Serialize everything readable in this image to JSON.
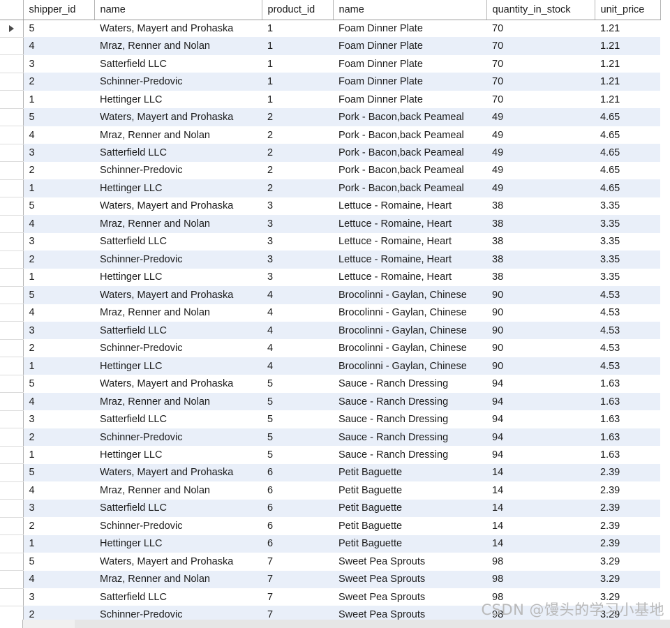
{
  "grid": {
    "columns": [
      {
        "key": "marker",
        "label": ""
      },
      {
        "key": "shipper_id",
        "label": "shipper_id"
      },
      {
        "key": "shipper_name",
        "label": "name"
      },
      {
        "key": "product_id",
        "label": "product_id"
      },
      {
        "key": "product_name",
        "label": "name"
      },
      {
        "key": "quantity_in_stock",
        "label": "quantity_in_stock"
      },
      {
        "key": "unit_price",
        "label": "unit_price"
      }
    ],
    "current_row_index": 0,
    "row_marker_icon": "triangle-right-icon",
    "colors": {
      "stripe": "#e9eff9",
      "background": "#ffffff",
      "grid_line": "#b4b4b4",
      "header_underline": "#9a9a9a",
      "text": "#1b1b1b"
    },
    "rows": [
      {
        "shipper_id": "5",
        "shipper_name": "Waters, Mayert and Prohaska",
        "product_id": "1",
        "product_name": "Foam Dinner Plate",
        "quantity_in_stock": "70",
        "unit_price": "1.21"
      },
      {
        "shipper_id": "4",
        "shipper_name": "Mraz, Renner and Nolan",
        "product_id": "1",
        "product_name": "Foam Dinner Plate",
        "quantity_in_stock": "70",
        "unit_price": "1.21"
      },
      {
        "shipper_id": "3",
        "shipper_name": "Satterfield LLC",
        "product_id": "1",
        "product_name": "Foam Dinner Plate",
        "quantity_in_stock": "70",
        "unit_price": "1.21"
      },
      {
        "shipper_id": "2",
        "shipper_name": "Schinner-Predovic",
        "product_id": "1",
        "product_name": "Foam Dinner Plate",
        "quantity_in_stock": "70",
        "unit_price": "1.21"
      },
      {
        "shipper_id": "1",
        "shipper_name": "Hettinger LLC",
        "product_id": "1",
        "product_name": "Foam Dinner Plate",
        "quantity_in_stock": "70",
        "unit_price": "1.21"
      },
      {
        "shipper_id": "5",
        "shipper_name": "Waters, Mayert and Prohaska",
        "product_id": "2",
        "product_name": "Pork - Bacon,back Peameal",
        "quantity_in_stock": "49",
        "unit_price": "4.65"
      },
      {
        "shipper_id": "4",
        "shipper_name": "Mraz, Renner and Nolan",
        "product_id": "2",
        "product_name": "Pork - Bacon,back Peameal",
        "quantity_in_stock": "49",
        "unit_price": "4.65"
      },
      {
        "shipper_id": "3",
        "shipper_name": "Satterfield LLC",
        "product_id": "2",
        "product_name": "Pork - Bacon,back Peameal",
        "quantity_in_stock": "49",
        "unit_price": "4.65"
      },
      {
        "shipper_id": "2",
        "shipper_name": "Schinner-Predovic",
        "product_id": "2",
        "product_name": "Pork - Bacon,back Peameal",
        "quantity_in_stock": "49",
        "unit_price": "4.65"
      },
      {
        "shipper_id": "1",
        "shipper_name": "Hettinger LLC",
        "product_id": "2",
        "product_name": "Pork - Bacon,back Peameal",
        "quantity_in_stock": "49",
        "unit_price": "4.65"
      },
      {
        "shipper_id": "5",
        "shipper_name": "Waters, Mayert and Prohaska",
        "product_id": "3",
        "product_name": "Lettuce - Romaine, Heart",
        "quantity_in_stock": "38",
        "unit_price": "3.35"
      },
      {
        "shipper_id": "4",
        "shipper_name": "Mraz, Renner and Nolan",
        "product_id": "3",
        "product_name": "Lettuce - Romaine, Heart",
        "quantity_in_stock": "38",
        "unit_price": "3.35"
      },
      {
        "shipper_id": "3",
        "shipper_name": "Satterfield LLC",
        "product_id": "3",
        "product_name": "Lettuce - Romaine, Heart",
        "quantity_in_stock": "38",
        "unit_price": "3.35"
      },
      {
        "shipper_id": "2",
        "shipper_name": "Schinner-Predovic",
        "product_id": "3",
        "product_name": "Lettuce - Romaine, Heart",
        "quantity_in_stock": "38",
        "unit_price": "3.35"
      },
      {
        "shipper_id": "1",
        "shipper_name": "Hettinger LLC",
        "product_id": "3",
        "product_name": "Lettuce - Romaine, Heart",
        "quantity_in_stock": "38",
        "unit_price": "3.35"
      },
      {
        "shipper_id": "5",
        "shipper_name": "Waters, Mayert and Prohaska",
        "product_id": "4",
        "product_name": "Brocolinni - Gaylan, Chinese",
        "quantity_in_stock": "90",
        "unit_price": "4.53"
      },
      {
        "shipper_id": "4",
        "shipper_name": "Mraz, Renner and Nolan",
        "product_id": "4",
        "product_name": "Brocolinni - Gaylan, Chinese",
        "quantity_in_stock": "90",
        "unit_price": "4.53"
      },
      {
        "shipper_id": "3",
        "shipper_name": "Satterfield LLC",
        "product_id": "4",
        "product_name": "Brocolinni - Gaylan, Chinese",
        "quantity_in_stock": "90",
        "unit_price": "4.53"
      },
      {
        "shipper_id": "2",
        "shipper_name": "Schinner-Predovic",
        "product_id": "4",
        "product_name": "Brocolinni - Gaylan, Chinese",
        "quantity_in_stock": "90",
        "unit_price": "4.53"
      },
      {
        "shipper_id": "1",
        "shipper_name": "Hettinger LLC",
        "product_id": "4",
        "product_name": "Brocolinni - Gaylan, Chinese",
        "quantity_in_stock": "90",
        "unit_price": "4.53"
      },
      {
        "shipper_id": "5",
        "shipper_name": "Waters, Mayert and Prohaska",
        "product_id": "5",
        "product_name": "Sauce - Ranch Dressing",
        "quantity_in_stock": "94",
        "unit_price": "1.63"
      },
      {
        "shipper_id": "4",
        "shipper_name": "Mraz, Renner and Nolan",
        "product_id": "5",
        "product_name": "Sauce - Ranch Dressing",
        "quantity_in_stock": "94",
        "unit_price": "1.63"
      },
      {
        "shipper_id": "3",
        "shipper_name": "Satterfield LLC",
        "product_id": "5",
        "product_name": "Sauce - Ranch Dressing",
        "quantity_in_stock": "94",
        "unit_price": "1.63"
      },
      {
        "shipper_id": "2",
        "shipper_name": "Schinner-Predovic",
        "product_id": "5",
        "product_name": "Sauce - Ranch Dressing",
        "quantity_in_stock": "94",
        "unit_price": "1.63"
      },
      {
        "shipper_id": "1",
        "shipper_name": "Hettinger LLC",
        "product_id": "5",
        "product_name": "Sauce - Ranch Dressing",
        "quantity_in_stock": "94",
        "unit_price": "1.63"
      },
      {
        "shipper_id": "5",
        "shipper_name": "Waters, Mayert and Prohaska",
        "product_id": "6",
        "product_name": "Petit Baguette",
        "quantity_in_stock": "14",
        "unit_price": "2.39"
      },
      {
        "shipper_id": "4",
        "shipper_name": "Mraz, Renner and Nolan",
        "product_id": "6",
        "product_name": "Petit Baguette",
        "quantity_in_stock": "14",
        "unit_price": "2.39"
      },
      {
        "shipper_id": "3",
        "shipper_name": "Satterfield LLC",
        "product_id": "6",
        "product_name": "Petit Baguette",
        "quantity_in_stock": "14",
        "unit_price": "2.39"
      },
      {
        "shipper_id": "2",
        "shipper_name": "Schinner-Predovic",
        "product_id": "6",
        "product_name": "Petit Baguette",
        "quantity_in_stock": "14",
        "unit_price": "2.39"
      },
      {
        "shipper_id": "1",
        "shipper_name": "Hettinger LLC",
        "product_id": "6",
        "product_name": "Petit Baguette",
        "quantity_in_stock": "14",
        "unit_price": "2.39"
      },
      {
        "shipper_id": "5",
        "shipper_name": "Waters, Mayert and Prohaska",
        "product_id": "7",
        "product_name": "Sweet Pea Sprouts",
        "quantity_in_stock": "98",
        "unit_price": "3.29"
      },
      {
        "shipper_id": "4",
        "shipper_name": "Mraz, Renner and Nolan",
        "product_id": "7",
        "product_name": "Sweet Pea Sprouts",
        "quantity_in_stock": "98",
        "unit_price": "3.29"
      },
      {
        "shipper_id": "3",
        "shipper_name": "Satterfield LLC",
        "product_id": "7",
        "product_name": "Sweet Pea Sprouts",
        "quantity_in_stock": "98",
        "unit_price": "3.29"
      },
      {
        "shipper_id": "2",
        "shipper_name": "Schinner-Predovic",
        "product_id": "7",
        "product_name": "Sweet Pea Sprouts",
        "quantity_in_stock": "98",
        "unit_price": "3.29"
      }
    ]
  },
  "watermark": {
    "text": "CSDN @馒头的学习小基地"
  }
}
